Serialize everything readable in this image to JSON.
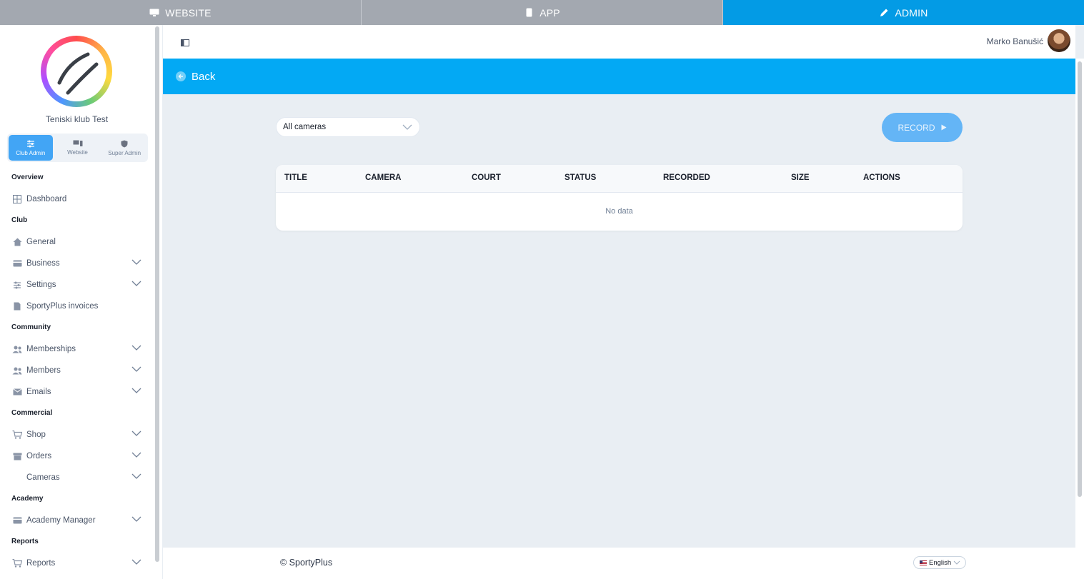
{
  "top_tabs": [
    {
      "label": "WEBSITE",
      "icon": "monitor-icon"
    },
    {
      "label": "APP",
      "icon": "phone-icon"
    },
    {
      "label": "ADMIN",
      "icon": "pencil-icon",
      "active": true
    }
  ],
  "sidebar": {
    "club_name": "Teniski klub Test",
    "modes": [
      {
        "label": "Club Admin",
        "icon": "sliders-icon",
        "active": true
      },
      {
        "label": "Website",
        "icon": "devices-icon"
      },
      {
        "label": "Super Admin",
        "icon": "shield-icon"
      }
    ],
    "sections": {
      "overview": "Overview",
      "club": "Club",
      "community": "Community",
      "commercial": "Commercial",
      "academy": "Academy",
      "reports": "Reports"
    },
    "items": {
      "dashboard": "Dashboard",
      "general": "General",
      "business": "Business",
      "settings": "Settings",
      "invoices": "SportyPlus invoices",
      "memberships": "Memberships",
      "members": "Members",
      "emails": "Emails",
      "shop": "Shop",
      "orders": "Orders",
      "cameras": "Cameras",
      "academy_manager": "Academy Manager",
      "reports": "Reports"
    }
  },
  "header": {
    "user_name": "Marko Banušić"
  },
  "backbar": {
    "back_label": "Back"
  },
  "filters": {
    "camera_select": "All cameras"
  },
  "actions": {
    "record_label": "RECORD"
  },
  "table": {
    "columns": [
      "TITLE",
      "CAMERA",
      "COURT",
      "STATUS",
      "RECORDED",
      "SIZE",
      "ACTIONS"
    ],
    "empty_text": "No data"
  },
  "footer": {
    "copyright": "© SportyPlus",
    "language": "English"
  },
  "colors": {
    "accent": "#03a9f4",
    "record_button": "#64b5f6",
    "top_tab_inactive": "#a3a8b0"
  }
}
